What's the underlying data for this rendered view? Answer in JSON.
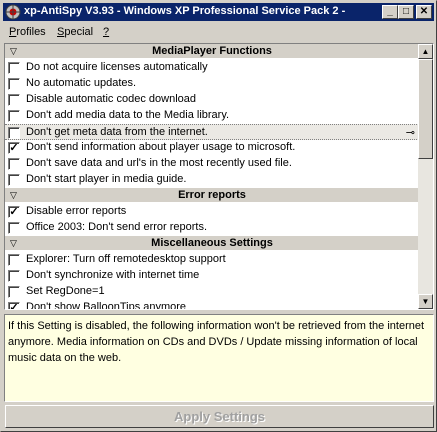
{
  "window": {
    "title": "xp-AntiSpy V3.93 - Windows XP Professional Service Pack 2 -",
    "min_glyph": "_",
    "max_glyph": "□",
    "close_glyph": "✕"
  },
  "menu": {
    "profiles": {
      "key": "P",
      "rest": "rofiles"
    },
    "special": {
      "key": "S",
      "rest": "pecial"
    },
    "help": {
      "key": "?",
      "rest": ""
    }
  },
  "sections": [
    {
      "title": "MediaPlayer Functions",
      "items": [
        {
          "label": "Do not acquire licenses automatically",
          "checked": false
        },
        {
          "label": "No automatic updates.",
          "checked": false
        },
        {
          "label": "Disable automatic codec download",
          "checked": false
        },
        {
          "label": "Don't add media data to the Media library.",
          "checked": false
        },
        {
          "label": "Don't get meta data from the internet.",
          "checked": false,
          "selected": true
        },
        {
          "label": "Don't send information about player usage to microsoft.",
          "checked": true
        },
        {
          "label": "Don't save data and url's in the most recently used file.",
          "checked": false
        },
        {
          "label": "Don't start player in media guide.",
          "checked": false
        }
      ]
    },
    {
      "title": "Error reports",
      "items": [
        {
          "label": "Disable error reports",
          "checked": true
        },
        {
          "label": "Office 2003: Don't send error reports.",
          "checked": false
        }
      ]
    },
    {
      "title": "Miscellaneous Settings",
      "items": [
        {
          "label": "Explorer: Turn off remotedesktop support",
          "checked": false
        },
        {
          "label": "Don't synchronize with internet time",
          "checked": false
        },
        {
          "label": "Set RegDone=1",
          "checked": false
        },
        {
          "label": "Don't show BalloonTips anymore",
          "checked": true
        }
      ]
    }
  ],
  "pin_glyph": "⊸",
  "description": "If this Setting is disabled, the following information won't be retrieved from the internet anymore. Media information on CDs and DVDs / Update missing information of local music data on the web.",
  "apply_label": "Apply Settings",
  "colors": {
    "titlebar": "#0a246a",
    "face": "#d4d0c8",
    "tooltip": "#ffffe1"
  }
}
